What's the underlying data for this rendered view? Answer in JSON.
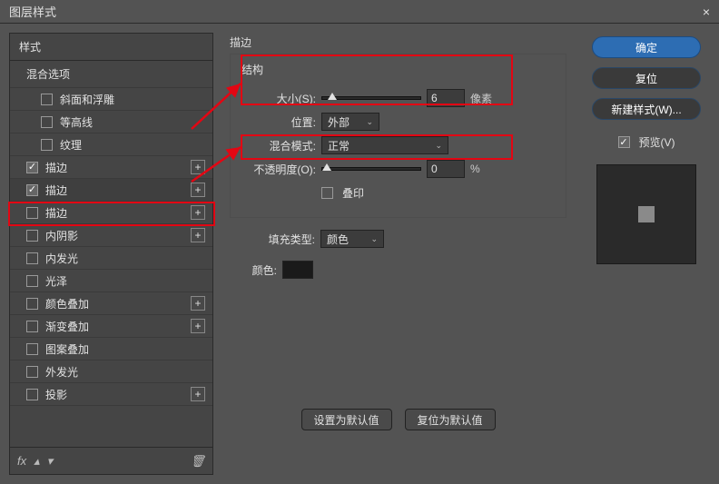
{
  "window": {
    "title": "图层样式"
  },
  "left": {
    "styles_header": "样式",
    "blend_options": "混合选项",
    "items": [
      {
        "label": "斜面和浮雕",
        "checked": false,
        "addable": false
      },
      {
        "label": "等高线",
        "checked": false,
        "addable": false
      },
      {
        "label": "纹理",
        "checked": false,
        "addable": false
      },
      {
        "label": "描边",
        "checked": true,
        "addable": true
      },
      {
        "label": "描边",
        "checked": true,
        "addable": true,
        "selected": true
      },
      {
        "label": "描边",
        "checked": false,
        "addable": true
      },
      {
        "label": "内阴影",
        "checked": false,
        "addable": true
      },
      {
        "label": "内发光",
        "checked": false,
        "addable": false
      },
      {
        "label": "光泽",
        "checked": false,
        "addable": false
      },
      {
        "label": "颜色叠加",
        "checked": false,
        "addable": true
      },
      {
        "label": "渐变叠加",
        "checked": false,
        "addable": true
      },
      {
        "label": "图案叠加",
        "checked": false,
        "addable": false
      },
      {
        "label": "外发光",
        "checked": false,
        "addable": false
      },
      {
        "label": "投影",
        "checked": false,
        "addable": true
      }
    ],
    "footer": {
      "fx": "fx",
      "trash": "🗑"
    }
  },
  "mid": {
    "section_title": "描边",
    "structure_label": "结构",
    "size_label": "大小(S):",
    "size_value": "6",
    "size_unit": "像素",
    "position_label": "位置:",
    "position_value": "外部",
    "blendmode_label": "混合模式:",
    "blendmode_value": "正常",
    "opacity_label": "不透明度(O):",
    "opacity_value": "0",
    "opacity_unit": "%",
    "overprint_label": "叠印",
    "filltype_label": "填充类型:",
    "filltype_value": "颜色",
    "color_label": "颜色:",
    "btn_default": "设置为默认值",
    "btn_reset": "复位为默认值"
  },
  "right": {
    "ok": "确定",
    "reset": "复位",
    "newstyle": "新建样式(W)...",
    "preview": "预览(V)",
    "preview_checked": true
  }
}
